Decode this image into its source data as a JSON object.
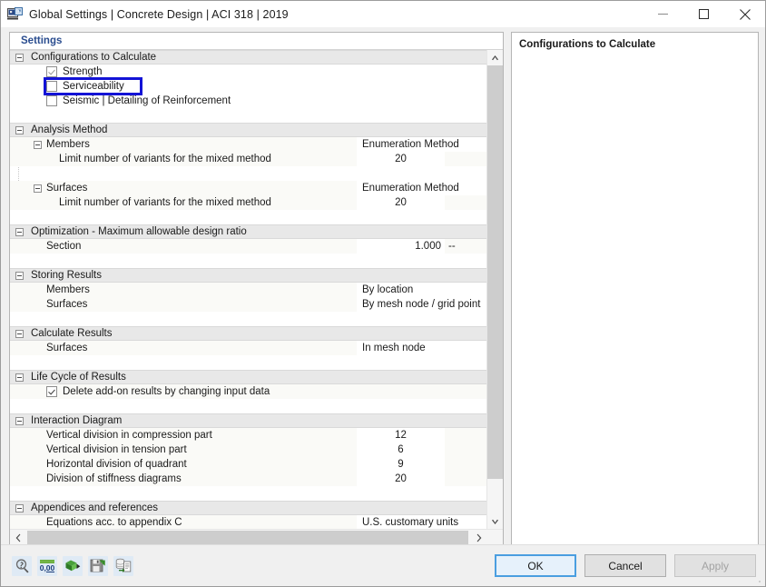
{
  "window": {
    "title": "Global Settings | Concrete Design | ACI 318 | 2019",
    "app_icon": "settings-window-icon",
    "minimize_label": "Minimize",
    "maximize_label": "Maximize",
    "close_label": "Close"
  },
  "left_panel": {
    "tab_label": "Settings",
    "groups": [
      {
        "id": "configurations",
        "title": "Configurations to Calculate",
        "rows": [
          {
            "type": "checkbox",
            "label": "Strength",
            "checked": true,
            "enabled": false
          },
          {
            "type": "checkbox",
            "label": "Serviceability",
            "checked": false,
            "selected": true
          },
          {
            "type": "checkbox",
            "label": "Seismic | Detailing of Reinforcement",
            "checked": false
          }
        ]
      },
      {
        "id": "analysis-method",
        "title": "Analysis Method",
        "rows": [
          {
            "type": "subgroup",
            "label": "Members",
            "value": "Enumeration Method"
          },
          {
            "type": "leaf",
            "label": "Limit number of variants for the mixed method",
            "value": "20"
          },
          {
            "type": "subgroup",
            "label": "Surfaces",
            "value": "Enumeration Method"
          },
          {
            "type": "leaf",
            "label": "Limit number of variants for the mixed method",
            "value": "20"
          }
        ]
      },
      {
        "id": "optimization",
        "title": "Optimization - Maximum allowable design ratio",
        "rows": [
          {
            "type": "leaf",
            "label": "Section",
            "value": "1.000",
            "unit": "--"
          }
        ]
      },
      {
        "id": "storing-results",
        "title": "Storing Results",
        "rows": [
          {
            "type": "leaf",
            "label": "Members",
            "value": "By location"
          },
          {
            "type": "leaf",
            "label": "Surfaces",
            "value": "By mesh node / grid point"
          }
        ]
      },
      {
        "id": "calculate-results",
        "title": "Calculate Results",
        "rows": [
          {
            "type": "leaf",
            "label": "Surfaces",
            "value": "In mesh node"
          }
        ]
      },
      {
        "id": "life-cycle",
        "title": "Life Cycle of Results",
        "rows": [
          {
            "type": "checkbox",
            "label": "Delete add-on results by changing input data",
            "checked": true
          }
        ]
      },
      {
        "id": "interaction-diagram",
        "title": "Interaction Diagram",
        "rows": [
          {
            "type": "leaf",
            "label": "Vertical division in compression part",
            "value": "12"
          },
          {
            "type": "leaf",
            "label": "Vertical division in tension part",
            "value": "6"
          },
          {
            "type": "leaf",
            "label": "Horizontal division of quadrant",
            "value": "9"
          },
          {
            "type": "leaf",
            "label": "Division of stiffness diagrams",
            "value": "20"
          }
        ]
      },
      {
        "id": "appendices",
        "title": "Appendices and references",
        "rows": [
          {
            "type": "leaf",
            "label": "Equations acc. to appendix C",
            "value": "U.S. customary units"
          }
        ]
      }
    ]
  },
  "right_panel": {
    "title": "Configurations to Calculate"
  },
  "footer": {
    "tools": [
      {
        "name": "search-settings-icon",
        "label": "Search"
      },
      {
        "name": "decimal-places-icon",
        "label": "0.00"
      },
      {
        "name": "import-settings-icon",
        "label": "Import"
      },
      {
        "name": "save-settings-icon",
        "label": "Save"
      },
      {
        "name": "copy-settings-icon",
        "label": "Copy"
      }
    ],
    "buttons": {
      "ok": "OK",
      "cancel": "Cancel",
      "apply": "Apply"
    }
  },
  "colors": {
    "selection_outline": "#1313d6",
    "tab_text": "#2a4d8f",
    "group_header_bg": "#e8e8e8",
    "focus_border": "#4a9ee0"
  }
}
